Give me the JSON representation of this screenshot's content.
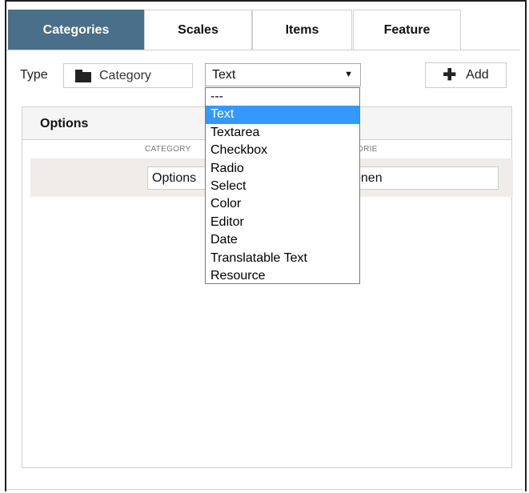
{
  "tabs": [
    {
      "label": "Categories",
      "active": true
    },
    {
      "label": "Scales",
      "active": false
    },
    {
      "label": "Items",
      "active": false
    },
    {
      "label": "Feature",
      "active": false
    }
  ],
  "toolbar": {
    "type_label": "Type",
    "type_value": "Category",
    "type_icon": "folder-icon",
    "select_value": "Text",
    "add_label": "Add",
    "add_icon": "plus-icon"
  },
  "options_panel": {
    "title": "Options",
    "columns": [
      "CATEGORY",
      "ORIE"
    ],
    "row": {
      "left_value": "Options",
      "right_value": "onen"
    }
  },
  "dropdown": {
    "options": [
      "---",
      "Text",
      "Textarea",
      "Checkbox",
      "Radio",
      "Select",
      "Color",
      "Editor",
      "Date",
      "Translatable Text",
      "Resource"
    ],
    "selected": "Text",
    "highlight_color": "#3399ff"
  },
  "colors": {
    "active_tab": "#4a6f8a",
    "row_background": "#f0ecea"
  }
}
